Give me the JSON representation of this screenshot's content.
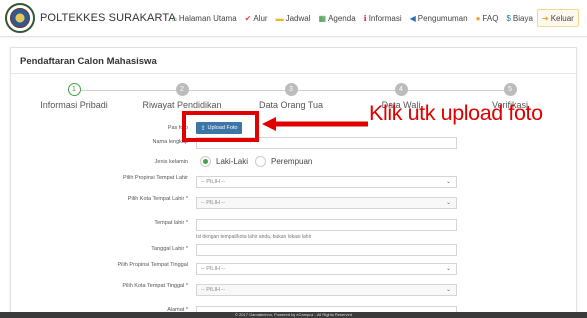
{
  "header": {
    "brand": "POLTEKKES SURAKARTA",
    "nav": [
      {
        "label": "Halaman Utama",
        "icon": "home-icon",
        "glyph": "⌂",
        "color": "#2e8b3a"
      },
      {
        "label": "Alur",
        "icon": "check-icon",
        "glyph": "✔",
        "color": "#e04848"
      },
      {
        "label": "Jadwal",
        "icon": "folder-icon",
        "glyph": "▬",
        "color": "#e8b830"
      },
      {
        "label": "Agenda",
        "icon": "calendar-icon",
        "glyph": "▦",
        "color": "#2e8b3a"
      },
      {
        "label": "Informasi",
        "icon": "info-icon",
        "glyph": "ℹ",
        "color": "#d03030"
      },
      {
        "label": "Pengumuman",
        "icon": "megaphone-icon",
        "glyph": "◀",
        "color": "#2f6fb3"
      },
      {
        "label": "FAQ",
        "icon": "question-icon",
        "glyph": "●",
        "color": "#f0a020"
      },
      {
        "label": "Biaya",
        "icon": "dollar-icon",
        "glyph": "$",
        "color": "#2f6fb3"
      },
      {
        "label": "Keluar",
        "icon": "logout-icon",
        "glyph": "➜",
        "color": "#e8a020"
      }
    ]
  },
  "page": {
    "title": "Pendaftaran Calon Mahasiswa",
    "steps": [
      {
        "num": "1",
        "label": "Informasi Pribadi",
        "active": true
      },
      {
        "num": "2",
        "label": "Riwayat Pendidikan",
        "active": false
      },
      {
        "num": "3",
        "label": "Data Orang Tua",
        "active": false
      },
      {
        "num": "4",
        "label": "Data Wali",
        "active": false
      },
      {
        "num": "5",
        "label": "Verifikasi",
        "active": false
      }
    ]
  },
  "form": {
    "pas_foto_label": "Pas foto",
    "upload_button": "Upload Foto",
    "nama_label": "Nama lengkap",
    "nama_value": "",
    "jenis_kelamin_label": "Jenis kelamin",
    "gender_options": [
      "Laki-Laki",
      "Perempuan"
    ],
    "gender_selected": "Laki-Laki",
    "prov_lahir_label": "Pilih Propinsi Tempat Lahir",
    "prov_lahir_value": "-- PILIH --",
    "kota_lahir_label": "Pilih Kota Tempat Lahir *",
    "kota_lahir_value": "-- PILIH --",
    "tempat_lahir_label": "Tempat lahir *",
    "tempat_lahir_value": "",
    "tempat_lahir_hint": "Isi dengan tempat/kota lahir anda, bukan lokasi lahir",
    "tanggal_lahir_label": "Tanggal Lahir *",
    "tanggal_lahir_value": "",
    "prov_tinggal_label": "Pilih Propinsi Tempat Tinggal",
    "prov_tinggal_value": "-- PILIH --",
    "kota_tinggal_label": "Pilih Kota Tempat Tinggal *",
    "kota_tinggal_value": "-- PILIH --",
    "alamat_label": "Alamat *"
  },
  "annotation": {
    "text": "Klik utk upload foto",
    "color": "#e00000"
  },
  "footer": {
    "text": "© 2017 Gamatechno, Powered by eCampuz - All Rights Reserved"
  }
}
